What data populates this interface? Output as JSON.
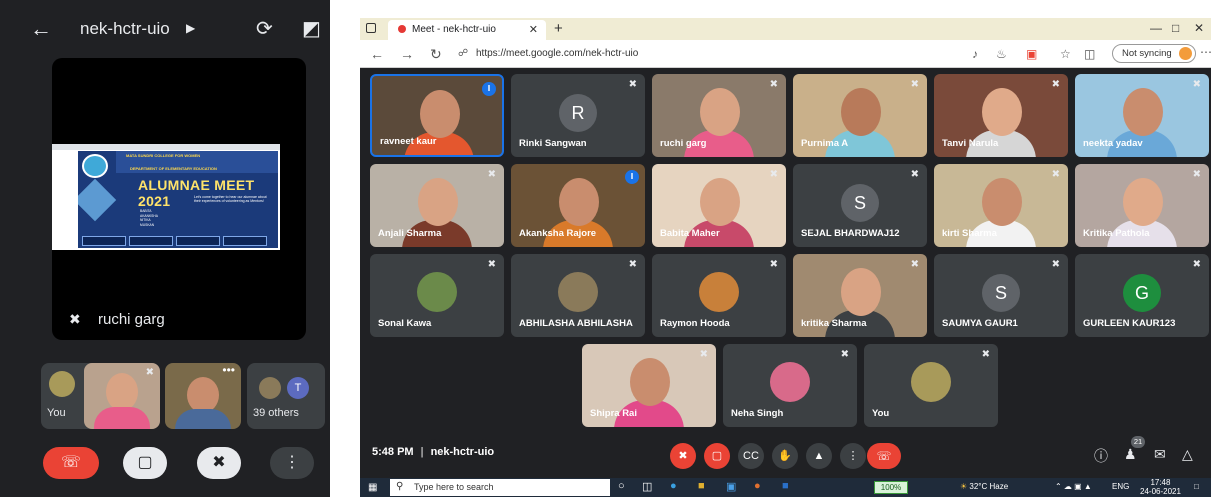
{
  "phone": {
    "meeting_code": "nek-hctr-uio",
    "main_participant": "ruchi garg",
    "slide": {
      "heading_line1": "MATA SUNDRI COLLEGE FOR WOMEN",
      "heading_line2": "DEPARTMENT OF ELEMENTARY EDUCATION",
      "title": "ALUMNAE MEET 2021",
      "tagline": "Let's come together to hear our alumnae about their experiences of volunteering as Mentors!",
      "roles": [
        "BABITA",
        "AKANKSHA",
        "NITIKA",
        "MUSKAN"
      ]
    },
    "tiles": [
      {
        "label": "You"
      },
      {
        "label": ""
      },
      {
        "label": ""
      },
      {
        "label": "39 others",
        "avatar_letter": "T"
      }
    ]
  },
  "browser": {
    "tab_title": "Meet - nek-hctr-uio",
    "url": "https://meet.google.com/nek-hctr-uio",
    "sync_label": "Not syncing"
  },
  "meet": {
    "participants": [
      {
        "name": "ravneet kaur",
        "kind": "video",
        "bg": "#5b4a3a",
        "skin": "#c98d6e",
        "cloth": "#e4572e",
        "active": true
      },
      {
        "name": "Rinki Sangwan",
        "kind": "avatar",
        "letter": "R",
        "color": "#5f6368"
      },
      {
        "name": "ruchi garg",
        "kind": "video",
        "bg": "#8a7a6a",
        "skin": "#d9a384",
        "cloth": "#e85d8a"
      },
      {
        "name": "Purnima A",
        "kind": "video",
        "bg": "#c9b08a",
        "skin": "#b87a5a",
        "cloth": "#7fc6d8"
      },
      {
        "name": "Tanvi Narula",
        "kind": "video",
        "bg": "#7a4a3a",
        "skin": "#e0aa8a",
        "cloth": "#d6d6d6"
      },
      {
        "name": "neekta yadav",
        "kind": "video",
        "bg": "#9ac6e0",
        "skin": "#c98d6e",
        "cloth": "#6aa8d8"
      },
      {
        "name": "Anjali Sharma",
        "kind": "video",
        "bg": "#b9b1a6",
        "skin": "#d9a384",
        "cloth": "#7a3a2a"
      },
      {
        "name": "Akanksha Rajore",
        "kind": "video",
        "bg": "#6b5236",
        "skin": "#c98d6e",
        "cloth": "#d97a2a",
        "speaking": true
      },
      {
        "name": "Babita Maher",
        "kind": "video",
        "bg": "#e6d4c0",
        "skin": "#d9a384",
        "cloth": "#c84a6a"
      },
      {
        "name": "SEJAL BHARDWAJ12",
        "kind": "avatar",
        "letter": "S",
        "color": "#5f6368"
      },
      {
        "name": "kirti Sharma",
        "kind": "video",
        "bg": "#c8b896",
        "skin": "#c98d6e",
        "cloth": "#f2f2f2"
      },
      {
        "name": "Kritika Pathola",
        "kind": "video",
        "bg": "#b4a6a0",
        "skin": "#e0aa8a",
        "cloth": "#e6e0ea"
      },
      {
        "name": "Sonal Kawa",
        "kind": "thumb",
        "color": "#6b8a4a"
      },
      {
        "name": "ABHILASHA ABHILASHA",
        "kind": "thumb",
        "color": "#8a7a5a"
      },
      {
        "name": "Raymon Hooda",
        "kind": "thumb",
        "color": "#c8803a"
      },
      {
        "name": "kritika Sharma",
        "kind": "video",
        "bg": "#a08a70",
        "skin": "#d9a384",
        "cloth": "#3c4043"
      },
      {
        "name": "SAUMYA GAUR1",
        "kind": "avatar",
        "letter": "S",
        "color": "#5f6368"
      },
      {
        "name": "GURLEEN KAUR123",
        "kind": "avatar",
        "letter": "G",
        "color": "#1e8e3e"
      },
      {
        "name": "Shipra Rai",
        "kind": "video",
        "bg": "#d8c8b8",
        "skin": "#c98d6e",
        "cloth": "#e24a8a"
      },
      {
        "name": "Neha Singh",
        "kind": "thumb",
        "color": "#d86a8a"
      },
      {
        "name": "You",
        "kind": "thumb",
        "color": "#a89a5a"
      }
    ],
    "time": "5:48 PM",
    "separator": "|",
    "meeting_code": "nek-hctr-uio",
    "people_count": "21"
  },
  "taskbar": {
    "search_placeholder": "Type here to search",
    "zoom_label": "100%",
    "weather": "32°C Haze",
    "lang": "ENG",
    "time": "17:48",
    "date": "24-06-2021"
  },
  "colors": {
    "meet_bg": "#202124",
    "tile_bg": "#3c4043",
    "end_call_red": "#ea4335",
    "speaking_blue": "#1a73e8"
  }
}
